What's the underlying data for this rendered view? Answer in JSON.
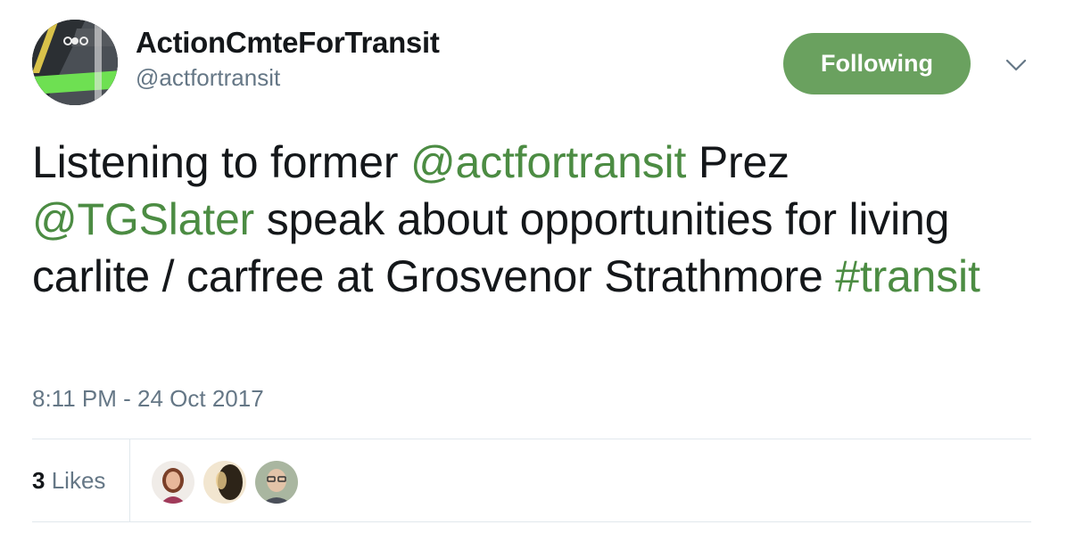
{
  "user": {
    "display_name": "ActionCmteForTransit",
    "handle": "@actfortransit",
    "avatar_icon": "bike-lane-avatar"
  },
  "follow_button": {
    "label": "Following",
    "color": "#6aa15f"
  },
  "menu_icon": "chevron-down-icon",
  "tweet": {
    "text_1": "Listening to former ",
    "mention_1": "@actfortransit",
    "text_2": " Prez ",
    "mention_2": "@TGSlater",
    "text_3": " speak about opportunities for living carlite / carfree at Grosvenor Strathmore ",
    "hashtag": "#transit",
    "link_color": "#4c8c43"
  },
  "timestamp": "8:11 PM - 24 Oct 2017",
  "stats": {
    "likes_count": "3",
    "likes_label": "Likes",
    "likers": [
      "liker-avatar-woman",
      "liker-avatar-silhouette",
      "liker-avatar-man-glasses"
    ]
  }
}
